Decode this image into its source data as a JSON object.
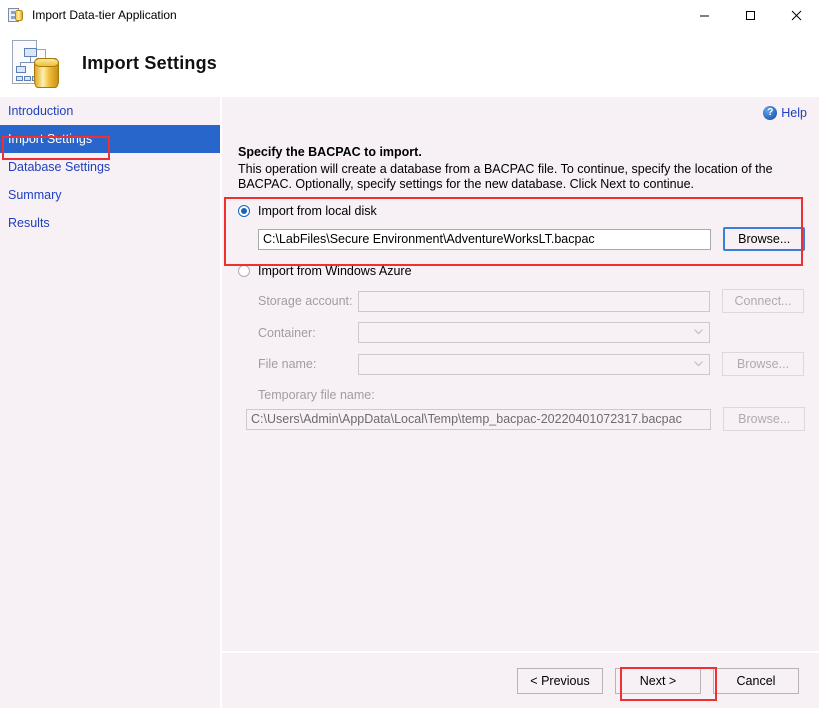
{
  "window": {
    "title": "Import Data-tier Application",
    "icon": "datatier-app-icon",
    "minimize": "—",
    "maximize": "☐",
    "close": "✕"
  },
  "header": {
    "title": "Import Settings",
    "icon": "import-settings-icon"
  },
  "sidebar": {
    "items": [
      {
        "label": "Introduction",
        "active": false
      },
      {
        "label": "Import Settings",
        "active": true
      },
      {
        "label": "Database Settings",
        "active": false
      },
      {
        "label": "Summary",
        "active": false
      },
      {
        "label": "Results",
        "active": false
      }
    ],
    "active_background": "#2866cc",
    "link_color": "#1f3fbf"
  },
  "help": {
    "label": "Help",
    "icon_glyph": "?"
  },
  "main": {
    "heading": "Specify the BACPAC to import.",
    "description": "This operation will create a database from a BACPAC file. To continue, specify the location of the BACPAC. Optionally, specify settings for the new database. Click Next to continue.",
    "local": {
      "radio_label": "Import from local disk",
      "selected": true,
      "path_value": "C:\\LabFiles\\Secure Environment\\AdventureWorksLT.bacpac",
      "browse_label": "Browse..."
    },
    "azure": {
      "radio_label": "Import from Windows Azure",
      "selected": false,
      "storage_account_label": "Storage account:",
      "storage_account_value": "",
      "connect_label": "Connect...",
      "container_label": "Container:",
      "container_value": "",
      "file_name_label": "File name:",
      "file_name_value": "",
      "file_browse_label": "Browse...",
      "temp_file_label": "Temporary file name:",
      "temp_file_value": "C:\\Users\\Admin\\AppData\\Local\\Temp\\temp_bacpac-20220401072317.bacpac",
      "temp_browse_label": "Browse..."
    }
  },
  "footer": {
    "previous_label": "< Previous",
    "next_label": "Next >",
    "cancel_label": "Cancel"
  },
  "annotations": {
    "color": "#f03030",
    "boxes": [
      {
        "name": "sidebar-import-settings-highlight"
      },
      {
        "name": "local-disk-section-highlight"
      },
      {
        "name": "next-button-highlight"
      }
    ]
  }
}
